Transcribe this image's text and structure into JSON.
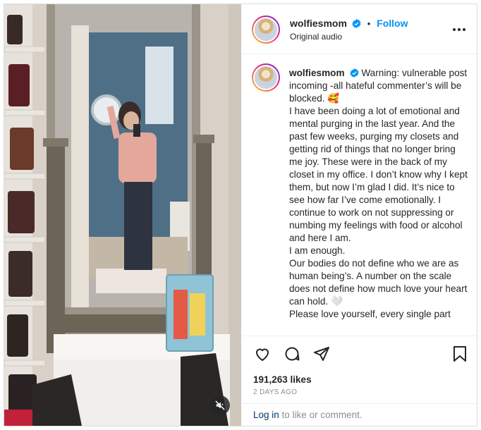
{
  "header": {
    "username": "wolfiesmom",
    "follow_label": "Follow",
    "audio_label": "Original audio",
    "separator": "•"
  },
  "caption": {
    "username": "wolfiesmom",
    "lines": [
      "Warning: vulnerable post incoming -all hateful commenter’s will be blocked. 🥰",
      "I have been doing a lot of emotional and mental purging in the last year. And the past few weeks, purging my closets and getting rid of things that no longer bring me joy. These were in the back of my closet in my office. I don’t know why I kept them, but now I’m glad I did. It’s nice to see how far I’ve come emotionally. I continue to work on not suppressing or numbing my feelings with food or alcohol and here I am.",
      "I am enough.",
      "Our bodies do not define who we are as human being’s. A number on the scale does not define how much love your heart can hold. 🤍",
      "Please love yourself, every single part"
    ]
  },
  "actions": {
    "likes_text": "191,263 likes",
    "date_text": "2 DAYS AGO"
  },
  "comment_bar": {
    "login_label": "Log in",
    "rest_text": " to like or comment."
  },
  "icons": {
    "verified": "verified-badge-icon",
    "more": "more-options-icon",
    "like": "heart-icon",
    "comment": "comment-bubble-icon",
    "share": "paper-plane-icon",
    "save": "bookmark-icon",
    "mute": "speaker-muted-icon"
  },
  "colors": {
    "accent": "#0095f6",
    "link": "#00376b",
    "verified": "#0095f6",
    "muted_text": "#8e8e8e"
  }
}
